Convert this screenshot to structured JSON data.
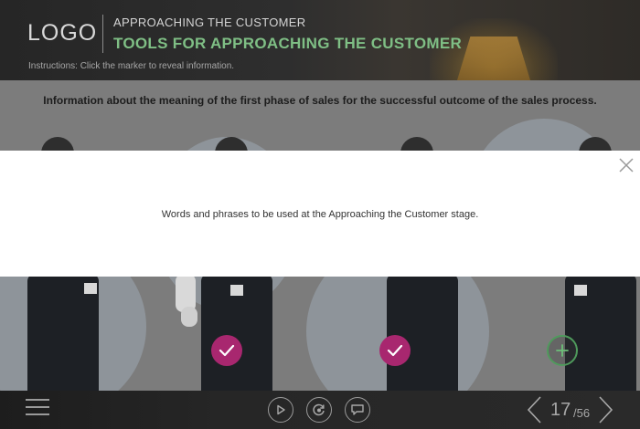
{
  "header": {
    "logo": "LOGO",
    "section_title": "APPROACHING THE CUSTOMER",
    "page_title": "TOOLS FOR APPROACHING THE CUSTOMER",
    "instructions": "Instructions: Click the marker to reveal information."
  },
  "slide": {
    "heading": "Information about the meaning of the first phase of sales for the successful outcome of the sales process.",
    "markers": [
      {
        "state": "visited",
        "icon": "checkmark-icon"
      },
      {
        "state": "visited",
        "icon": "checkmark-icon"
      },
      {
        "state": "unvisited",
        "icon": "plus-icon"
      }
    ]
  },
  "popup": {
    "text": "Words and phrases to be used at the Approaching the Customer stage."
  },
  "footer": {
    "page_current": "17",
    "page_total": "/56"
  },
  "colors": {
    "accent_green": "#7fbf85",
    "visited_marker": "#a8276f",
    "unvisited_marker_border": "#4f9a5c"
  }
}
